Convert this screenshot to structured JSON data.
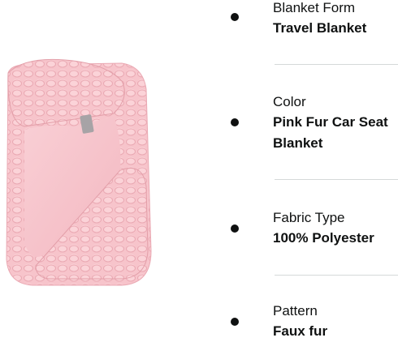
{
  "product_image": {
    "alt": "Pink Fur Car Seat Blanket",
    "colors": {
      "blanket": "#f7c4cb",
      "blanket_shadow": "#eaa9b3",
      "blanket_highlight": "#fbd6db",
      "tag": "#a7a3a6"
    }
  },
  "attributes": [
    {
      "label": "Blanket Form",
      "value": "Travel Blanket"
    },
    {
      "label": "Color",
      "value": "Pink Fur Car Seat Blanket"
    },
    {
      "label": "Fabric Type",
      "value": "100% Polyester"
    },
    {
      "label": "Pattern",
      "value": "Faux fur"
    }
  ],
  "theme": {
    "text": "#0f1111",
    "divider": "#d5d9d9",
    "background": "#ffffff"
  }
}
